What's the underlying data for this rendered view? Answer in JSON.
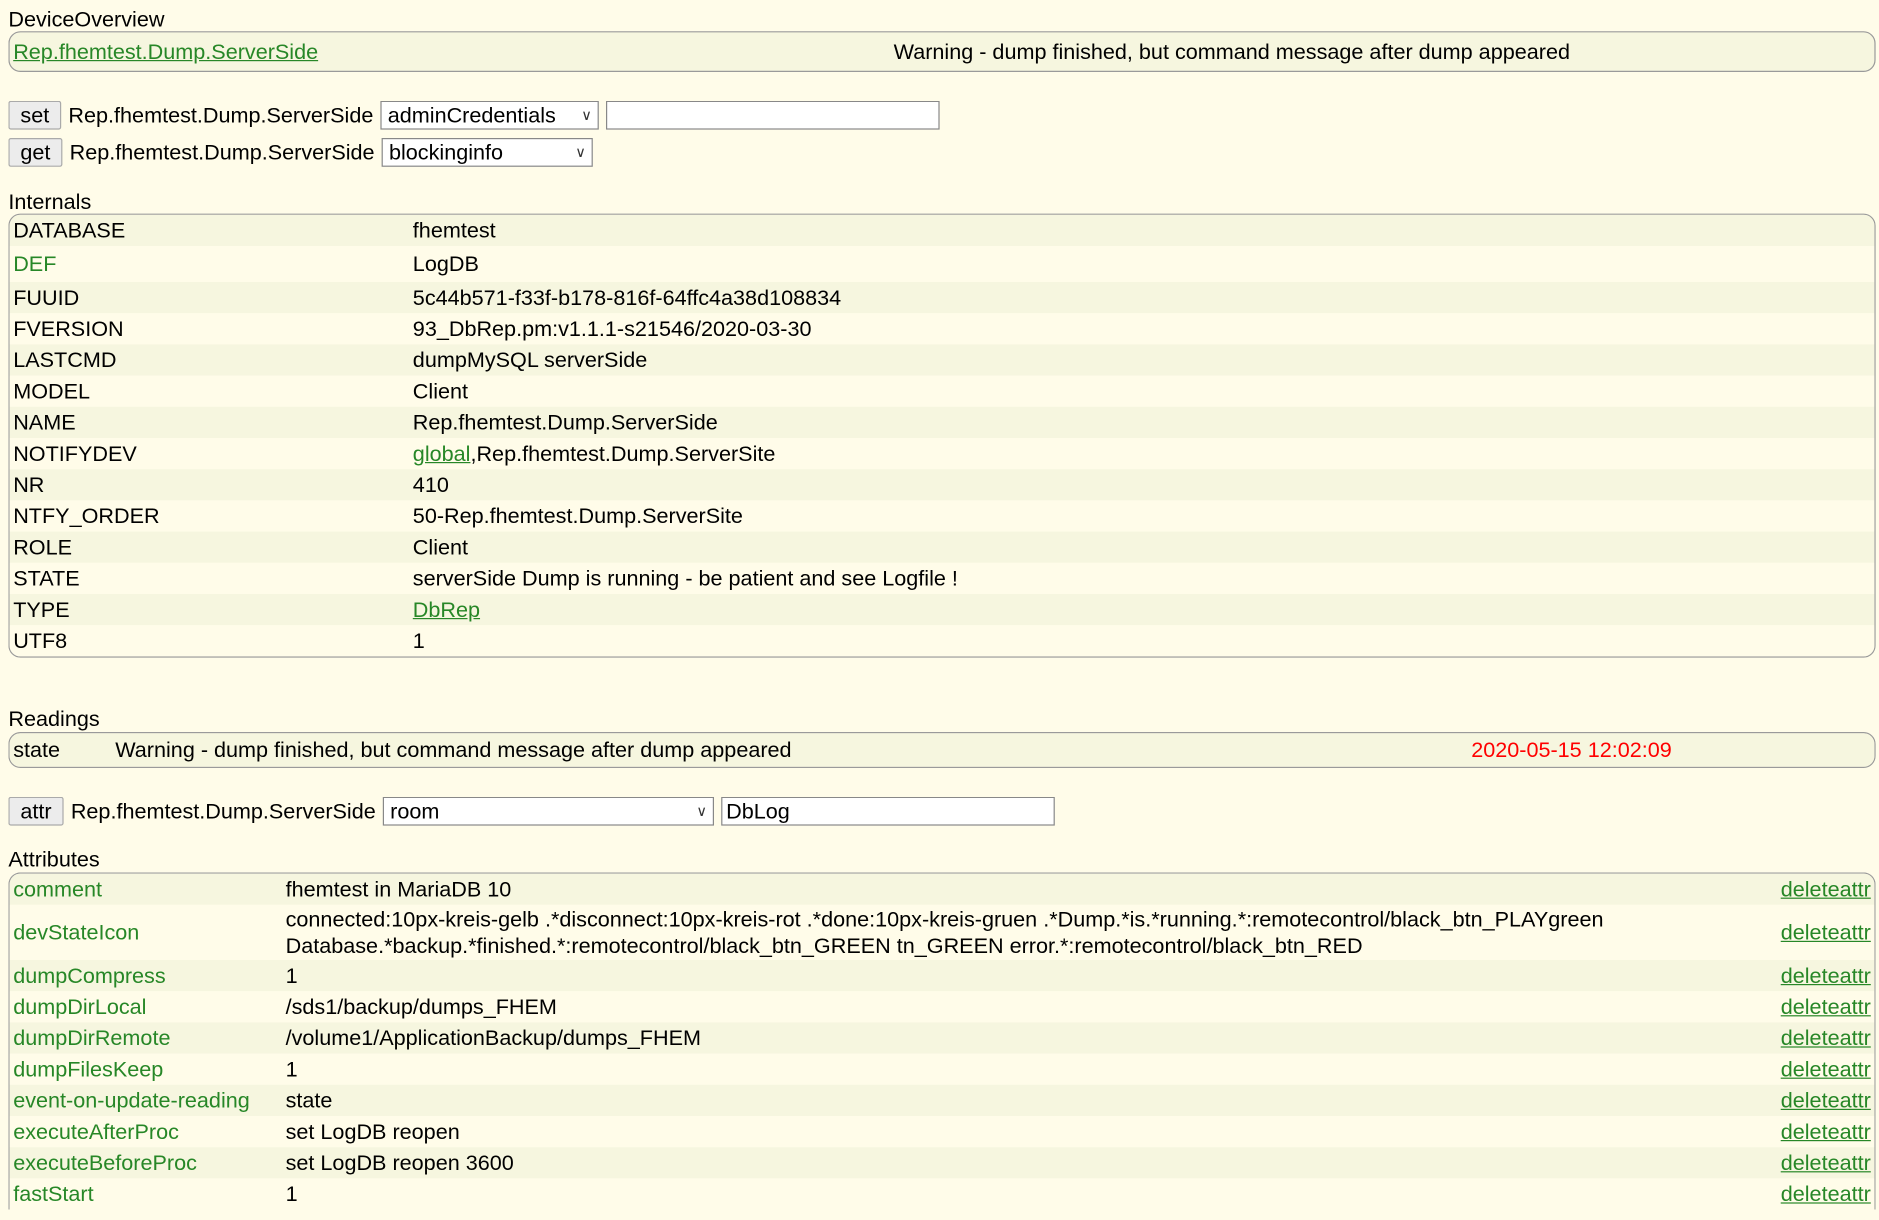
{
  "overview": {
    "title": "DeviceOverview",
    "device_link": "Rep.fhemtest.Dump.ServerSide",
    "status": "Warning - dump finished, but command message after dump appeared"
  },
  "set_cmd": {
    "button": "set",
    "device": "Rep.fhemtest.Dump.ServerSide",
    "selected": "adminCredentials",
    "value": ""
  },
  "get_cmd": {
    "button": "get",
    "device": "Rep.fhemtest.Dump.ServerSide",
    "selected": "blockinginfo"
  },
  "internals": {
    "title": "Internals",
    "rows": [
      {
        "name": "DATABASE",
        "value": "fhemtest"
      },
      {
        "name": "DEF",
        "value": "LogDB"
      },
      {
        "name": "FUUID",
        "value": "5c44b571-f33f-b178-816f-64ffc4a38d108834"
      },
      {
        "name": "FVERSION",
        "value": "93_DbRep.pm:v1.1.1-s21546/2020-03-30"
      },
      {
        "name": "LASTCMD",
        "value": "dumpMySQL serverSide"
      },
      {
        "name": "MODEL",
        "value": "Client"
      },
      {
        "name": "NAME",
        "value": "Rep.fhemtest.Dump.ServerSide"
      },
      {
        "name": "NOTIFYDEV",
        "value_link": "global",
        "value": ",Rep.fhemtest.Dump.ServerSite"
      },
      {
        "name": "NR",
        "value": "410"
      },
      {
        "name": "NTFY_ORDER",
        "value": "50-Rep.fhemtest.Dump.ServerSite"
      },
      {
        "name": "ROLE",
        "value": "Client"
      },
      {
        "name": "STATE",
        "value": "serverSide Dump is running - be patient and see Logfile !"
      },
      {
        "name": "TYPE",
        "value_link": "DbRep"
      },
      {
        "name": "UTF8",
        "value": "1"
      }
    ]
  },
  "readings": {
    "title": "Readings",
    "rows": [
      {
        "name": "state",
        "value": "Warning - dump finished, but command message after dump appeared",
        "timestamp": "2020-05-15 12:02:09"
      }
    ]
  },
  "attr_cmd": {
    "button": "attr",
    "device": "Rep.fhemtest.Dump.ServerSide",
    "selected": "room",
    "value": "DbLog"
  },
  "attributes": {
    "title": "Attributes",
    "delete_label": "deleteattr",
    "rows": [
      {
        "name": "comment",
        "value": "fhemtest in MariaDB 10"
      },
      {
        "name": "devStateIcon",
        "value": "connected:10px-kreis-gelb .*disconnect:10px-kreis-rot .*done:10px-kreis-gruen .*Dump.*is.*running.*:remotecontrol/black_btn_PLAYgreen",
        "value2": "Database.*backup.*finished.*:remotecontrol/black_btn_GREEN tn_GREEN error.*:remotecontrol/black_btn_RED"
      },
      {
        "name": "dumpCompress",
        "value": "1"
      },
      {
        "name": "dumpDirLocal",
        "value": "/sds1/backup/dumps_FHEM"
      },
      {
        "name": "dumpDirRemote",
        "value": "/volume1/ApplicationBackup/dumps_FHEM"
      },
      {
        "name": "dumpFilesKeep",
        "value": "1"
      },
      {
        "name": "event-on-update-reading",
        "value": "state"
      },
      {
        "name": "executeAfterProc",
        "value": "set LogDB reopen"
      },
      {
        "name": "executeBeforeProc",
        "value": "set LogDB reopen 3600"
      },
      {
        "name": "fastStart",
        "value": "1"
      }
    ]
  }
}
